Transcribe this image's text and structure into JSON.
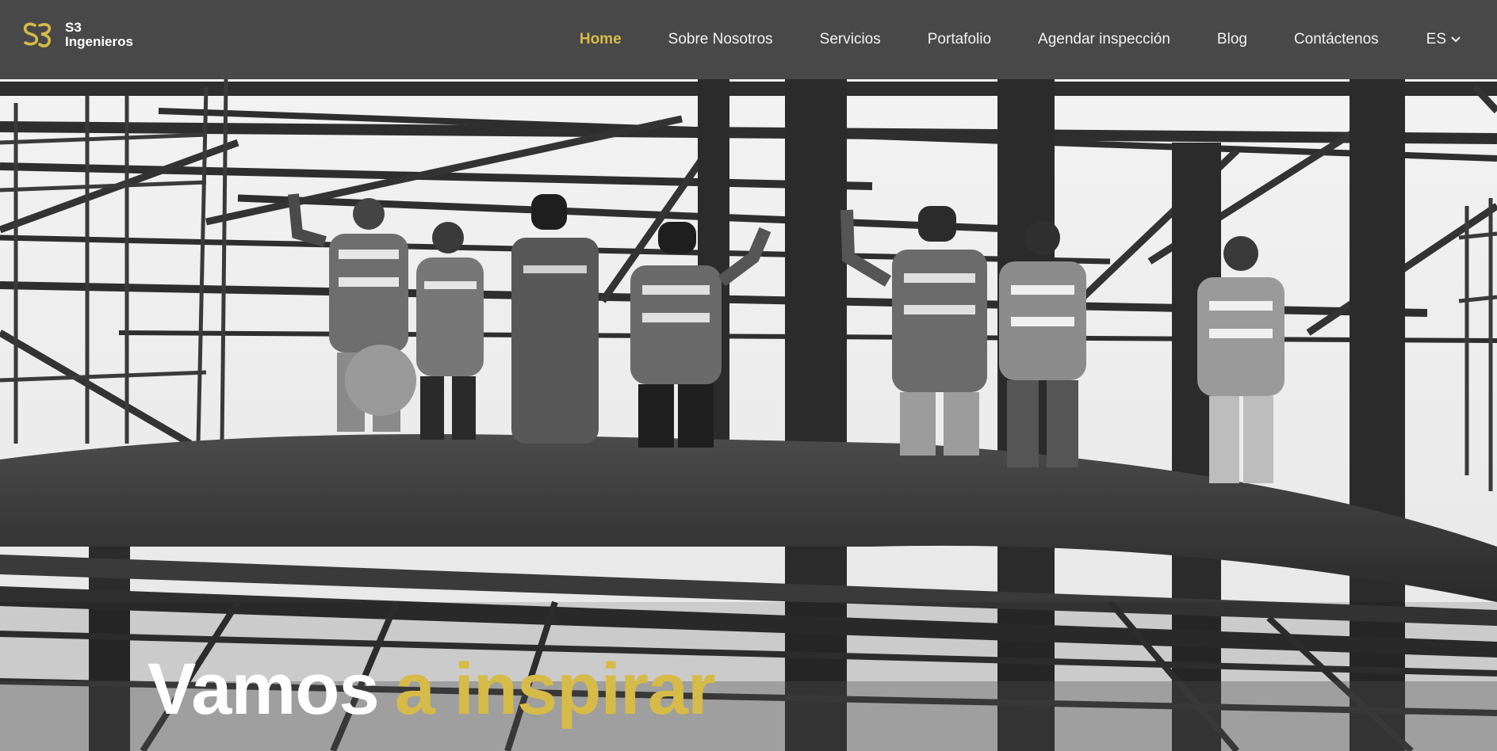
{
  "brand": {
    "line1": "S3",
    "line2": "Ingenieros",
    "accent_color": "#d6bb48"
  },
  "nav": {
    "items": [
      {
        "label": "Home",
        "active": true
      },
      {
        "label": "Sobre Nosotros"
      },
      {
        "label": "Servicios"
      },
      {
        "label": "Portafolio"
      },
      {
        "label": "Agendar inspección"
      },
      {
        "label": "Blog"
      },
      {
        "label": "Contáctenos"
      }
    ],
    "language": "ES",
    "language_icon": "chevron-down-icon"
  },
  "hero": {
    "title_part1": "Vamos",
    "title_part2": "a inspirar",
    "image": "grayscale photo of construction workers on a steel structure"
  }
}
